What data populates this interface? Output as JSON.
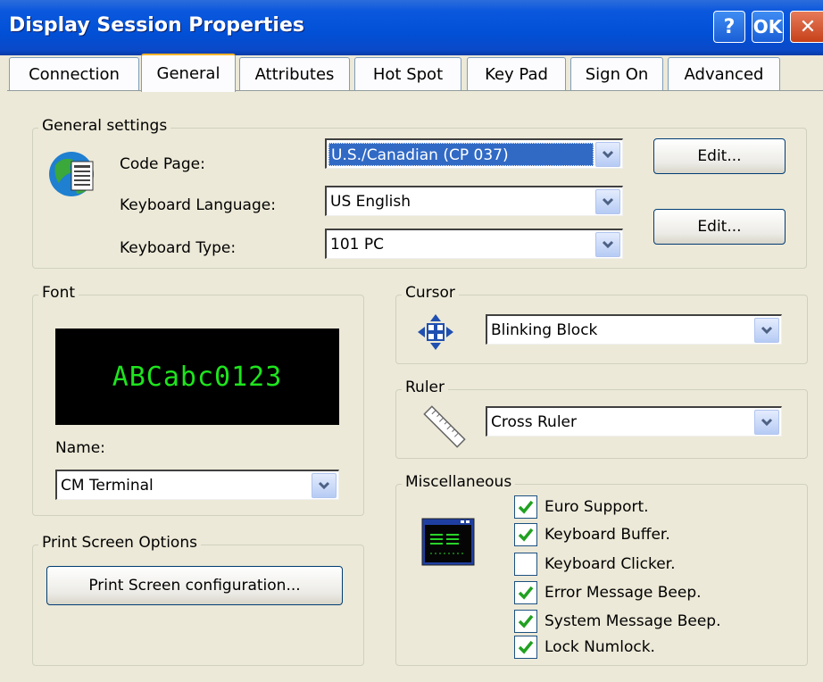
{
  "window": {
    "title": "Display Session Properties",
    "help_label": "?",
    "ok_label": "OK",
    "close_label": "✕"
  },
  "tabs": [
    {
      "label": "Connection",
      "active": false
    },
    {
      "label": "General",
      "active": true
    },
    {
      "label": "Attributes",
      "active": false
    },
    {
      "label": "Hot Spot",
      "active": false
    },
    {
      "label": "Key Pad",
      "active": false
    },
    {
      "label": "Sign On",
      "active": false
    },
    {
      "label": "Advanced",
      "active": false
    }
  ],
  "general": {
    "legend": "General settings",
    "code_page": {
      "label": "Code Page:",
      "value": "U.S./Canadian (CP 037)"
    },
    "keyboard_language": {
      "label": "Keyboard Language:",
      "value": "US English"
    },
    "keyboard_type": {
      "label": "Keyboard Type:",
      "value": "101 PC"
    },
    "edit_label_1": "Edit...",
    "edit_label_2": "Edit..."
  },
  "font": {
    "legend": "Font",
    "preview_text": "ABCabc0123",
    "name_label": "Name:",
    "name_value": "CM Terminal"
  },
  "print_screen": {
    "legend": "Print Screen Options",
    "button_label": "Print Screen configuration..."
  },
  "cursor": {
    "legend": "Cursor",
    "value": "Blinking Block"
  },
  "ruler": {
    "legend": "Ruler",
    "value": "Cross Ruler"
  },
  "misc": {
    "legend": "Miscellaneous",
    "items": [
      {
        "label": "Euro Support.",
        "checked": true
      },
      {
        "label": "Keyboard Buffer.",
        "checked": true
      },
      {
        "label": "Keyboard Clicker.",
        "checked": false
      },
      {
        "label": "Error Message Beep.",
        "checked": true
      },
      {
        "label": "System Message Beep.",
        "checked": true
      },
      {
        "label": "Lock Numlock.",
        "checked": true
      }
    ]
  },
  "colors": {
    "titlebar": "#0150d6",
    "dialog_bg": "#ece9d8",
    "preview_text": "#1ee41e",
    "check_mark": "#21a121"
  }
}
